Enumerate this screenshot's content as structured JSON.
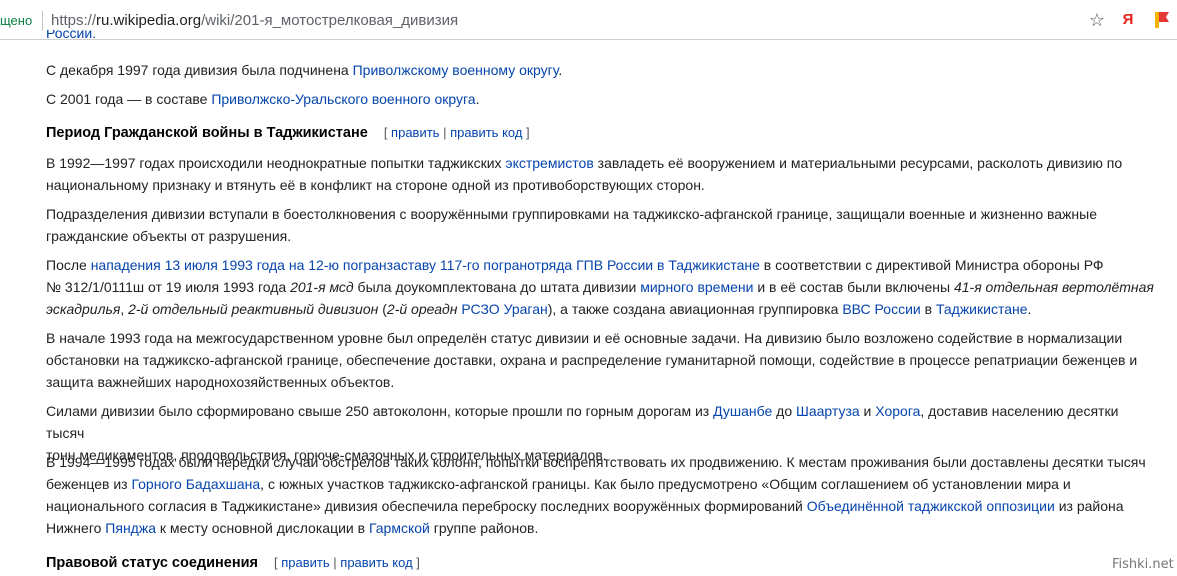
{
  "browser": {
    "secure_label": "щено",
    "url_scheme": "https://",
    "url_domain": "ru.wikipedia.org",
    "url_path": "/wiki/201-я_мотострелковая_дивизия",
    "bookmark_icon": "star-icon",
    "yandex_label": "Я",
    "extension_icon": "bookmark-flag-icon"
  },
  "article": {
    "top_fragment": "России.",
    "p_dec1997": {
      "t1": "С декабря 1997 года дивизия была подчинена ",
      "l1": "Приволжскому военному округу",
      "t2": "."
    },
    "p_2001": {
      "t1": "С 2001 года — в составе ",
      "l1": "Приволжско-Уральского военного округа",
      "t2": "."
    },
    "section1": {
      "title": "Период Гражданской войны в Таджикистане",
      "lb": "[ ",
      "edit": "править",
      "sep": " | ",
      "edit_code": "править код",
      "rb": " ]"
    },
    "p1": {
      "t1": "В 1992—1997 годах происходили неоднократные попытки таджикских ",
      "l1": "экстремистов",
      "t2": " завладеть её вооружением и материальными ресурсами, расколоть дивизию по",
      "t3": "национальному признаку и втянуть её в конфликт на стороне одной из противоборствующих сторон."
    },
    "p2": {
      "t1": "Подразделения дивизии вступали в боестолкновения с вооружёнными группировками на таджикско-афганской границе, защищали военные и жизненно важные",
      "t2": "гражданские объекты от разрушения."
    },
    "p3": {
      "t1": "После ",
      "l1": "нападения 13 июля 1993 года на 12-ю погранзаставу 117-го погранотряда ГПВ России в Таджикистане",
      "t2": " в соответствии с директивой Министра обороны РФ",
      "t3": "№ 312/1/0111ш от 19 июля 1993 года ",
      "e1": "201-я мсд",
      "t4": " была доукомплектована до штата дивизии ",
      "l2": "мирного времени",
      "t5": " и в её состав были включены ",
      "e2": "41-я отдельная вертолётная",
      "e3": "эскадрилья",
      "t6": ", ",
      "e4": "2-й отдельный реактивный дивизион",
      "t7": " (",
      "e5": "2-й ореадн",
      "t8": " ",
      "l3": "РСЗО Ураган",
      "t9": "), а также создана авиационная группировка ",
      "l4": "ВВС России",
      "t10": " в ",
      "l5": "Таджикистане",
      "t11": "."
    },
    "p4": {
      "t1": "В начале 1993 года на межгосударственном уровне был определён статус дивизии и её основные задачи. На дивизию было возложено содействие в нормализации",
      "t2": "обстановки на таджикско-афганской границе, обеспечение доставки, охрана и распределение гуманитарной помощи, содействие в процессе репатриации беженцев и",
      "t3": "защита важнейших народнохозяйственных объектов."
    },
    "p5": {
      "t1": "Силами дивизии было сформировано свыше 250 автоколонн, которые прошли по горным дорогам из ",
      "l1": "Душанбе",
      "t2": " до ",
      "l2": "Шаартуза",
      "t3": " и ",
      "l3": "Хорога",
      "t4": ", доставив населению десятки тысяч",
      "t5": "тонн медикаментов, продовольствия, горюче-смазочных и строительных материалов."
    },
    "p6": {
      "t1": "В 1994—1995 годах были нередки случаи обстрелов таких колонн, попытки воспрепятствовать их продвижению. К местам проживания были доставлены десятки тысяч",
      "t2": "беженцев из ",
      "l1": "Горного Бадахшана",
      "t3": ", с южных участков таджикско-афганской границы. Как было предусмотрено «Общим соглашением об установлении мира и",
      "t4": "национального согласия в Таджикистане» дивизия обеспечила переброску последних вооружённых формирований ",
      "l2": "Объединённой таджикской оппозиции",
      "t5": " из района",
      "t6": "Нижнего ",
      "l3": "Пянджа",
      "t7": " к месту основной дислокации в ",
      "l4": "Гармской",
      "t8": " группе районов."
    },
    "section2": {
      "title": "Правовой статус соединения",
      "lb": "[ ",
      "edit": "править",
      "sep": " | ",
      "edit_code": "править код",
      "rb": " ]"
    }
  },
  "watermark": "Fishki.net"
}
